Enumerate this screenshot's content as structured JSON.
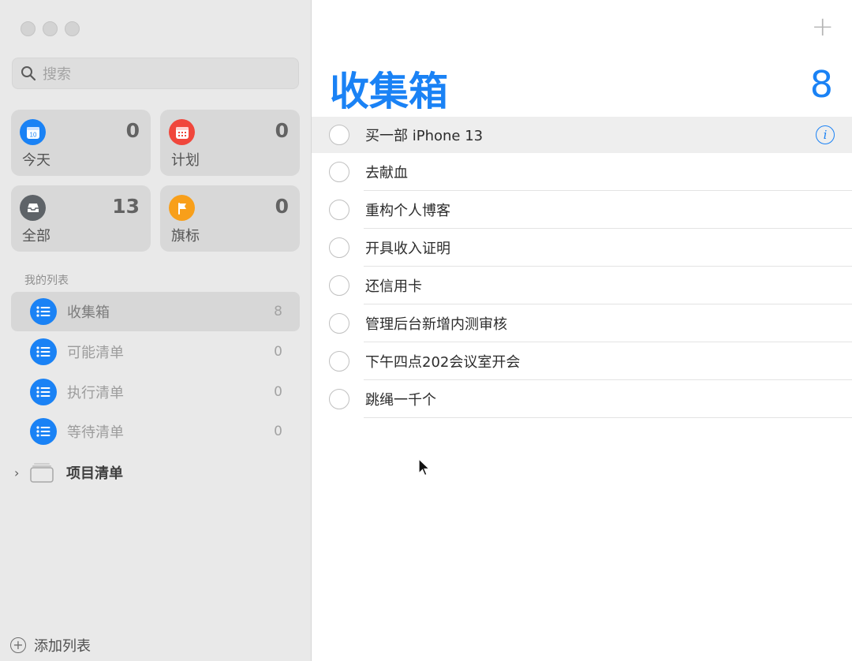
{
  "search": {
    "placeholder": "搜索"
  },
  "smart_lists": [
    {
      "label": "今天",
      "count": "0",
      "icon": "calendar-today-icon",
      "color": "#1a82f5"
    },
    {
      "label": "计划",
      "count": "0",
      "icon": "calendar-scheduled-icon",
      "color": "#f0473c"
    },
    {
      "label": "全部",
      "count": "13",
      "icon": "tray-icon",
      "color": "#5e6368"
    },
    {
      "label": "旗标",
      "count": "0",
      "icon": "flag-icon",
      "color": "#f89f1a"
    }
  ],
  "my_lists": {
    "title": "我的列表",
    "items": [
      {
        "name": "收集箱",
        "count": "8"
      },
      {
        "name": "可能清单",
        "count": "0"
      },
      {
        "name": "执行清单",
        "count": "0"
      },
      {
        "name": "等待清单",
        "count": "0"
      }
    ],
    "group": {
      "name": "项目清单"
    }
  },
  "add_list": {
    "label": "添加列表"
  },
  "main": {
    "title": "收集箱",
    "count": "8",
    "add_symbol": "+",
    "tasks": [
      {
        "text": "买一部 iPhone 13"
      },
      {
        "text": "去献血"
      },
      {
        "text": "重构个人博客"
      },
      {
        "text": "开具收入证明"
      },
      {
        "text": "还信用卡"
      },
      {
        "text": "管理后台新增内测审核"
      },
      {
        "text": "下午四点202会议室开会"
      },
      {
        "text": "跳绳一千个"
      }
    ],
    "info_symbol": "i"
  },
  "colors": {
    "accent": "#1a82f5"
  }
}
